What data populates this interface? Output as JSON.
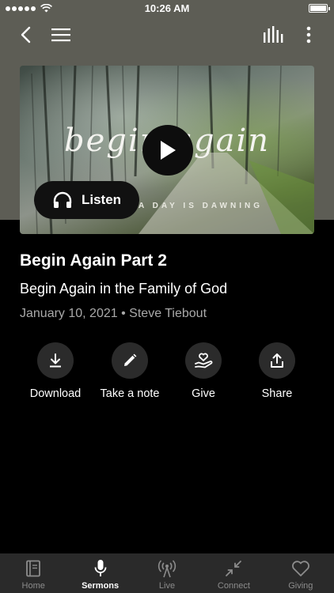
{
  "status_bar": {
    "time": "10:26 AM"
  },
  "nav": {
    "back_icon": "chevron-left-icon",
    "menu_icon": "hamburger-icon",
    "equalizer_icon": "equalizer-icon",
    "more_icon": "more-vertical-icon"
  },
  "artwork": {
    "script_text": "begin again",
    "tagline": "A DAY IS DAWNING",
    "listen_label": "Listen"
  },
  "sermon": {
    "title": "Begin Again Part 2",
    "subtitle": "Begin Again in the Family of God",
    "date": "January 10, 2021",
    "separator": "•",
    "speaker": "Steve Tiebout"
  },
  "actions": [
    {
      "label": "Download",
      "icon": "download-icon"
    },
    {
      "label": "Take a note",
      "icon": "pencil-icon"
    },
    {
      "label": "Give",
      "icon": "give-hand-heart-icon"
    },
    {
      "label": "Share",
      "icon": "share-icon"
    }
  ],
  "tabs": [
    {
      "label": "Home",
      "icon": "book-icon",
      "active": false
    },
    {
      "label": "Sermons",
      "icon": "microphone-icon",
      "active": true
    },
    {
      "label": "Live",
      "icon": "broadcast-icon",
      "active": false
    },
    {
      "label": "Connect",
      "icon": "connect-arrows-icon",
      "active": false
    },
    {
      "label": "Giving",
      "icon": "heart-icon",
      "active": false
    }
  ],
  "colors": {
    "header_bg": "#5d5d55",
    "page_bg": "#000000",
    "action_circle": "#2b2b2b",
    "tab_bar_bg": "#2a2a2a",
    "meta_text": "#a9a9a9"
  }
}
